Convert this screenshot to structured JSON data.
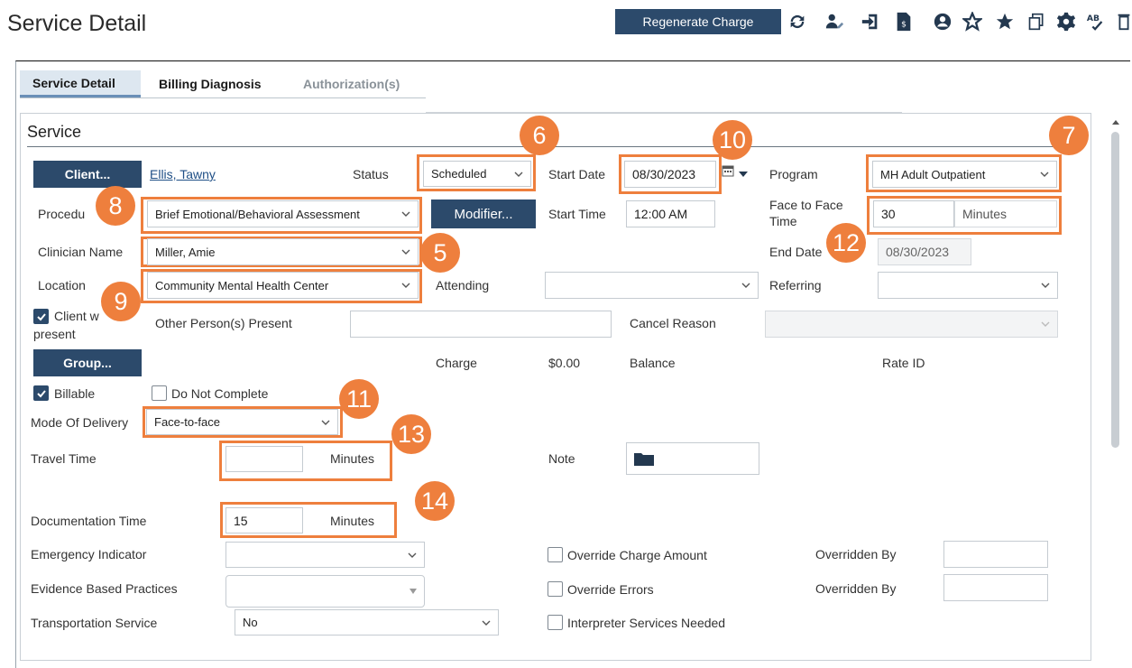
{
  "header": {
    "title": "Service Detail",
    "regenerate_label": "Regenerate Charge",
    "icons": [
      "refresh-icon",
      "user-edit-icon",
      "sign-in-icon",
      "document-dollar-icon",
      "user-circle-icon",
      "star-outline-icon",
      "star-filled-icon",
      "copy-icon",
      "gear-icon",
      "spell-check-icon",
      "trash-icon"
    ]
  },
  "tabs": [
    {
      "label": "Service Detail",
      "state": "active"
    },
    {
      "label": "Billing Diagnosis",
      "state": "normal"
    },
    {
      "label": "Authorization(s)",
      "state": "disabled"
    }
  ],
  "section_title": "Service",
  "client": {
    "button": "Client...",
    "name": "Ellis, Tawny"
  },
  "status": {
    "label": "Status",
    "value": "Scheduled"
  },
  "start_date": {
    "label": "Start Date",
    "value": "08/30/2023"
  },
  "program": {
    "label": "Program",
    "value": "MH Adult Outpatient"
  },
  "procedure": {
    "label": "Procedure",
    "label_visible": "Procedu",
    "value": "Brief Emotional/Behavioral Assessment"
  },
  "modifier_button": "Modifier...",
  "start_time": {
    "label": "Start Time",
    "value": "12:00 AM"
  },
  "face_to_face": {
    "label_line1": "Face to Face",
    "label_line2": "Time",
    "value": "30",
    "unit": "Minutes"
  },
  "clinician": {
    "label": "Clinician Name",
    "value": "Miller, Amie"
  },
  "end_date": {
    "label": "End Date",
    "label_visible": "End Date",
    "value": "08/30/2023"
  },
  "location": {
    "label": "Location",
    "value": "Community Mental Health Center"
  },
  "attending": {
    "label": "Attending",
    "value": ""
  },
  "referring": {
    "label": "Referring",
    "value": ""
  },
  "client_present": {
    "label_line1": "Client w",
    "label_line2": "present",
    "checked": true
  },
  "other_persons": {
    "label": "Other Person(s) Present",
    "value": ""
  },
  "cancel_reason": {
    "label": "Cancel Reason",
    "value": ""
  },
  "group_button": "Group...",
  "charge": {
    "label": "Charge",
    "value": "$0.00"
  },
  "balance": {
    "label": "Balance"
  },
  "rate_id": {
    "label": "Rate ID"
  },
  "billable": {
    "label": "Billable",
    "checked": true
  },
  "do_not_complete": {
    "label": "Do Not Complete",
    "checked": false
  },
  "mode_of_delivery": {
    "label": "Mode Of Delivery",
    "value": "Face-to-face"
  },
  "travel_time": {
    "label": "Travel Time",
    "value": "",
    "unit": "Minutes"
  },
  "note": {
    "label": "Note"
  },
  "documentation_time": {
    "label": "Documentation Time",
    "value": "15",
    "unit": "Minutes"
  },
  "emergency_indicator": {
    "label": "Emergency Indicator",
    "value": ""
  },
  "override_charge": {
    "label": "Override Charge Amount",
    "checked": false
  },
  "overridden_by_1": {
    "label": "Overridden By",
    "value": ""
  },
  "evidence_based": {
    "label": "Evidence Based Practices",
    "value": ""
  },
  "override_errors": {
    "label": "Override Errors",
    "checked": false
  },
  "overridden_by_2": {
    "label": "Overridden By",
    "value": ""
  },
  "transportation": {
    "label": "Transportation Service",
    "value": "No"
  },
  "interpreter": {
    "label": "Interpreter Services Needed",
    "checked": false
  },
  "badges": [
    "5",
    "6",
    "7",
    "8",
    "9",
    "10",
    "11",
    "12",
    "13",
    "14"
  ],
  "colors": {
    "accent": "#2c4a6b",
    "highlight": "#ee7f3d",
    "link": "#1f4f86"
  }
}
